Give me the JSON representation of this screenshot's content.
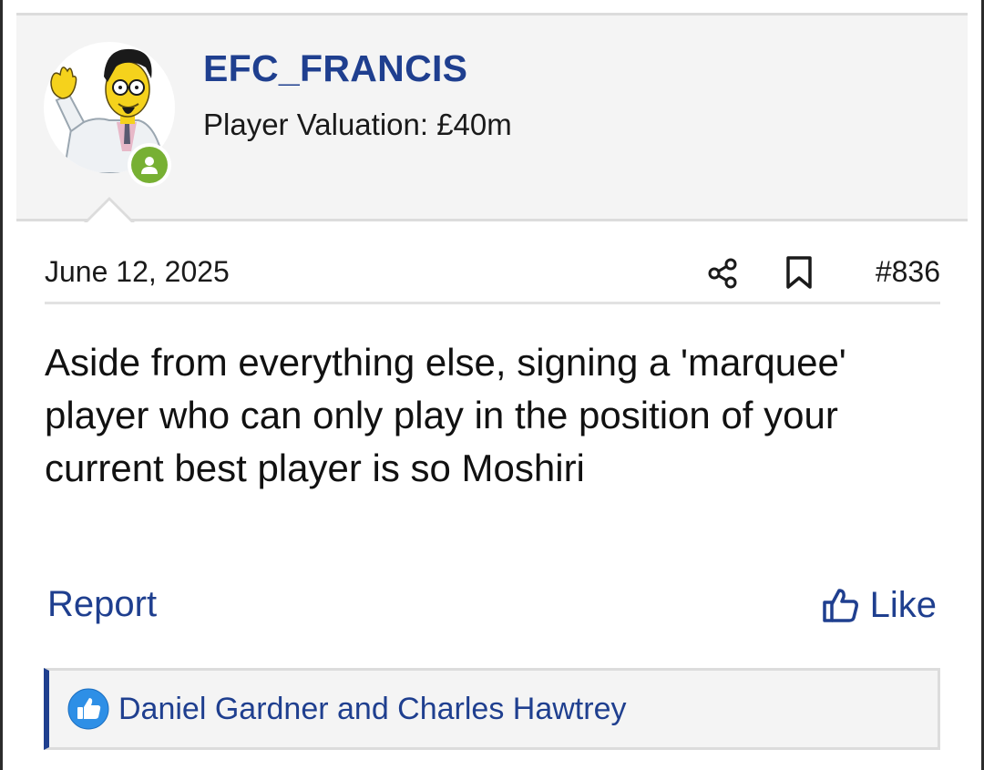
{
  "post": {
    "username": "EFC_FRANCIS",
    "user_title": "Player Valuation: £40m",
    "date": "June 12, 2025",
    "post_number": "#836",
    "body": "Aside from everything else, signing a 'marquee' player who can only play in the position of your current best player is so Moshiri",
    "online_status_icon": "online-user-icon"
  },
  "actions": {
    "report_label": "Report",
    "like_label": "Like",
    "share_icon": "share-icon",
    "bookmark_icon": "bookmark-icon",
    "like_icon": "thumbs-up-icon"
  },
  "reactions": {
    "icon": "like-reaction-icon",
    "text": "Daniel Gardner and Charles Hawtrey"
  },
  "colors": {
    "accent": "#1f3f8f",
    "online": "#77b033",
    "reaction": "#2e8fe6",
    "header_bg": "#f4f4f4"
  }
}
